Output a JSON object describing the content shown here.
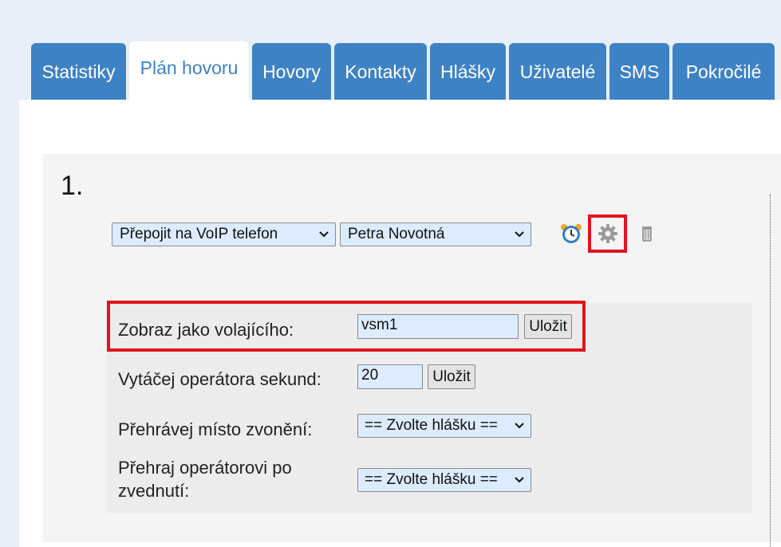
{
  "tabs": [
    {
      "label": "Statistiky"
    },
    {
      "label": "Plán hovoru"
    },
    {
      "label": "Hovory"
    },
    {
      "label": "Kontakty"
    },
    {
      "label": "Hlášky"
    },
    {
      "label": "Uživatelé"
    },
    {
      "label": "SMS"
    },
    {
      "label": "Pokročilé"
    }
  ],
  "active_tab": "Plán hovoru",
  "step": {
    "number": "1.",
    "action_select": "Přepojit na VoIP telefon",
    "target_select": "Petra Novotná",
    "icons": [
      "alarm-clock-icon",
      "gear-icon",
      "trash-can-icon"
    ]
  },
  "settings": {
    "caller_id": {
      "label": "Zobraz jako volajícího:",
      "value": "vsm1",
      "button": "Uložit"
    },
    "dial_seconds": {
      "label": "Vytáčej operátora sekund:",
      "value": "20",
      "button": "Uložit"
    },
    "ring_play": {
      "label": "Přehrávej místo zvonění:",
      "select": "== Zvolte hlášku =="
    },
    "on_pickup": {
      "label_line1": "Přehraj operátorovi po",
      "label_line2": "zvednutí:",
      "select": "== Zvolte hlášku =="
    }
  },
  "colors": {
    "tab": "#3e82c6",
    "input_bg": "#dcebfd",
    "highlight": "#e0141e"
  }
}
